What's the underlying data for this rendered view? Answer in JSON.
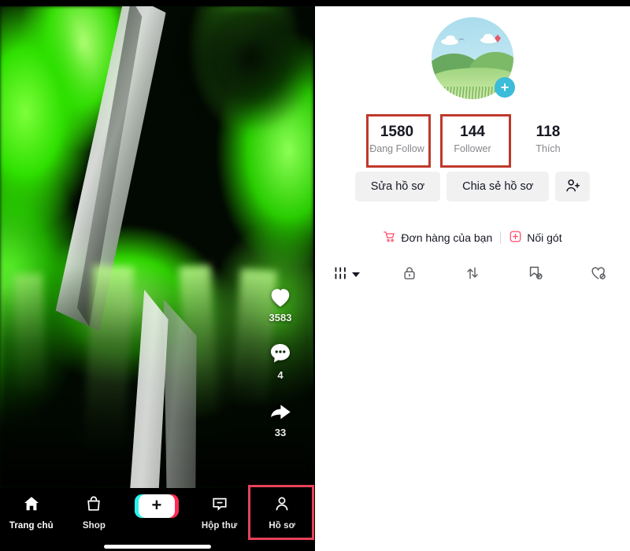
{
  "app": "TikTok",
  "video": {
    "description": "green-flame-video",
    "actions": [
      {
        "icon": "heart-icon",
        "name": "like",
        "count": "3583"
      },
      {
        "icon": "comment-icon",
        "name": "comment",
        "count": "4"
      },
      {
        "icon": "share-icon",
        "name": "share",
        "count": "33"
      }
    ]
  },
  "bottom_nav": {
    "items": [
      {
        "label": "Trang chủ",
        "icon": "home-icon",
        "active": true
      },
      {
        "label": "Shop",
        "icon": "shop-bag-icon",
        "active": false
      },
      {
        "label": "",
        "icon": "create-plus-icon",
        "active": false
      },
      {
        "label": "Hộp thư",
        "icon": "inbox-icon",
        "active": false
      },
      {
        "label": "Hồ sơ",
        "icon": "person-icon",
        "active": false
      }
    ],
    "highlighted_item": "Hồ sơ"
  },
  "profile": {
    "avatar": {
      "alt": "landscape-avatar",
      "badge": "+"
    },
    "stats": [
      {
        "value": "1580",
        "label": "Đang Follow",
        "highlighted": true
      },
      {
        "value": "144",
        "label": "Follower",
        "highlighted": true
      },
      {
        "value": "118",
        "label": "Thích",
        "highlighted": false
      }
    ],
    "buttons": {
      "edit_profile": "Sửa hồ sơ",
      "share_profile": "Chia sẻ hồ sơ",
      "add_friend_icon": "add-person-icon"
    },
    "links": [
      {
        "label": "Đơn hàng của bạn",
        "icon": "shopping-cart-icon"
      },
      {
        "label": "Nối gót",
        "icon": "plus-box-icon"
      }
    ],
    "tabs": [
      {
        "name": "grid-tab",
        "icon": "grid-columns-icon"
      },
      {
        "name": "private-tab",
        "icon": "lock-icon"
      },
      {
        "name": "repost-tab",
        "icon": "repost-arrows-icon"
      },
      {
        "name": "saved-tab",
        "icon": "bookmark-slash-icon"
      },
      {
        "name": "liked-tab",
        "icon": "heart-slash-icon"
      }
    ]
  },
  "colors": {
    "highlight_red": "#c0392b",
    "highlight_pink": "#e8415a",
    "accent_pink": "#fe2c55",
    "accent_cyan": "#25f4ee",
    "text_primary": "#161823",
    "text_secondary": "#86878b",
    "pill_bg": "#f1f1f2"
  }
}
